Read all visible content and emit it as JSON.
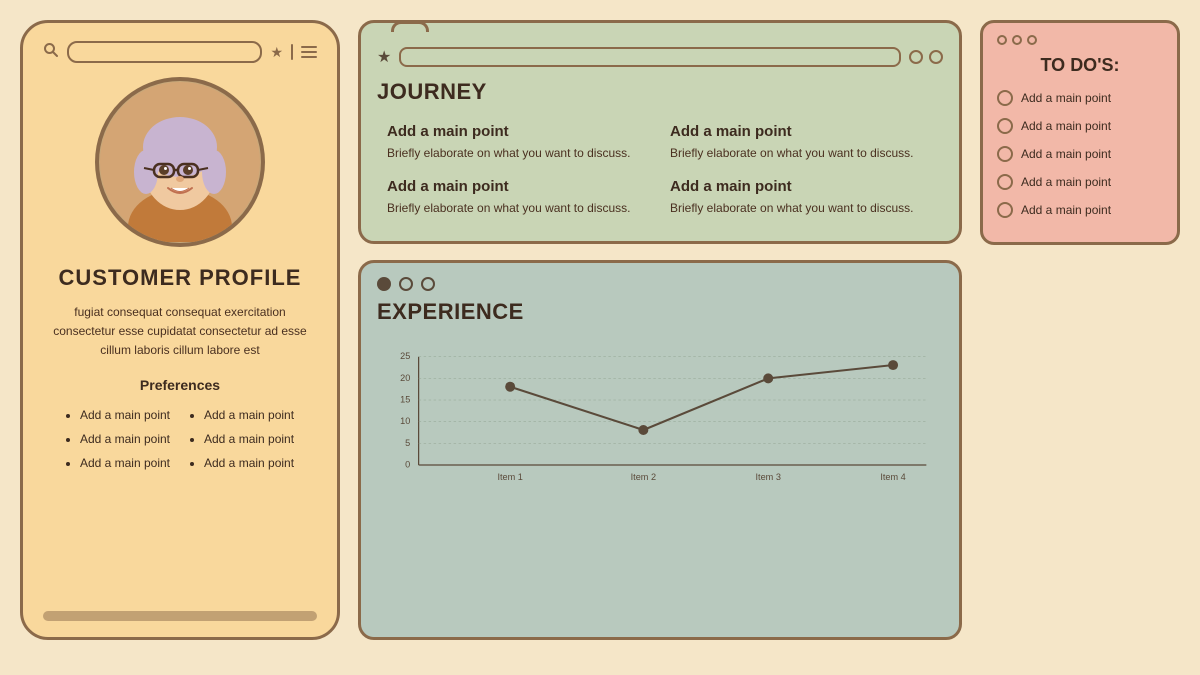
{
  "profile": {
    "title": "CUSTOMER PROFILE",
    "description": "fugiat consequat consequat exercitation consectetur esse cupidatat consectetur ad esse cillum laboris cillum labore est",
    "preferences_title": "Preferences",
    "preferences_col1": [
      "Add a main point",
      "Add a main point",
      "Add a main point"
    ],
    "preferences_col2": [
      "Add a main point",
      "Add a main point",
      "Add a main point"
    ]
  },
  "journey": {
    "title": "JOURNEY",
    "items": [
      {
        "title": "Add a main point",
        "desc": "Briefly elaborate on what you want to discuss."
      },
      {
        "title": "Add a main point",
        "desc": "Briefly elaborate on what you want to discuss."
      },
      {
        "title": "Add a main point",
        "desc": "Briefly elaborate on what you want to discuss."
      },
      {
        "title": "Add a main point",
        "desc": "Briefly elaborate on what you want to discuss."
      }
    ]
  },
  "experience": {
    "title": "EXPERIENCE",
    "chart": {
      "yMax": 25,
      "yStep": 5,
      "labels": [
        "Item 1",
        "Item 2",
        "Item 3",
        "Item 4"
      ],
      "values": [
        18,
        8,
        20,
        23
      ]
    }
  },
  "todo": {
    "title": "TO DO'S:",
    "items": [
      "Add a main point",
      "Add a main point",
      "Add a main point",
      "Add a main point",
      "Add a main point"
    ]
  }
}
